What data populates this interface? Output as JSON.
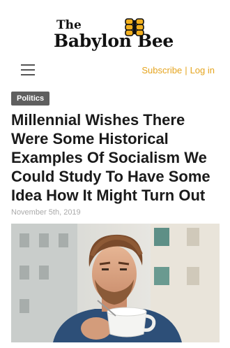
{
  "brand": {
    "logo_top": "The",
    "logo_bottom": "Babylon Bee",
    "accent": "#e5a41e"
  },
  "nav": {
    "menu_icon": "hamburger-icon",
    "subscribe": "Subscribe",
    "separator": "|",
    "login": "Log in"
  },
  "article": {
    "category": "Politics",
    "headline": "Millennial Wishes There Were Some Historical Examples Of Socialism We Could Study To Have Some Idea How It Might Turn Out",
    "date": "November 5th, 2019"
  }
}
